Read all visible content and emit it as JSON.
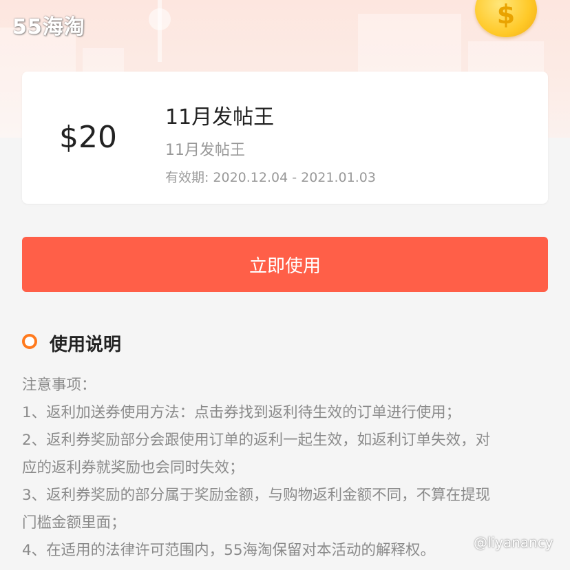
{
  "header": {
    "logo_text": "55海淘"
  },
  "coupon": {
    "amount": "$20",
    "title": "11月发帖王",
    "subtitle": "11月发帖王",
    "validity_label": "有效期:",
    "validity_range": "2020.12.04 - 2021.01.03"
  },
  "actions": {
    "use_now": "立即使用"
  },
  "instructions": {
    "section_title": "使用说明",
    "lines": [
      "注意事项：",
      "1、返利加送券使用方法：点击券找到返利待生效的订单进行使用；",
      "2、返利券奖励部分会跟使用订单的返利一起生效，如返利订单失效，对",
      "应的返利券就奖励也会同时失效；",
      "3、返利券奖励的部分属于奖励金额，与购物返利金额不同，不算在提现",
      "门槛金额里面；",
      "4、在适用的法律许可范围内，55海淘保留对本活动的解释权。"
    ]
  },
  "watermark": "@liyanancy",
  "colors": {
    "accent": "#ff5f48",
    "section_dot": "#ff7a1e",
    "hero_bg": "#fde6df"
  }
}
